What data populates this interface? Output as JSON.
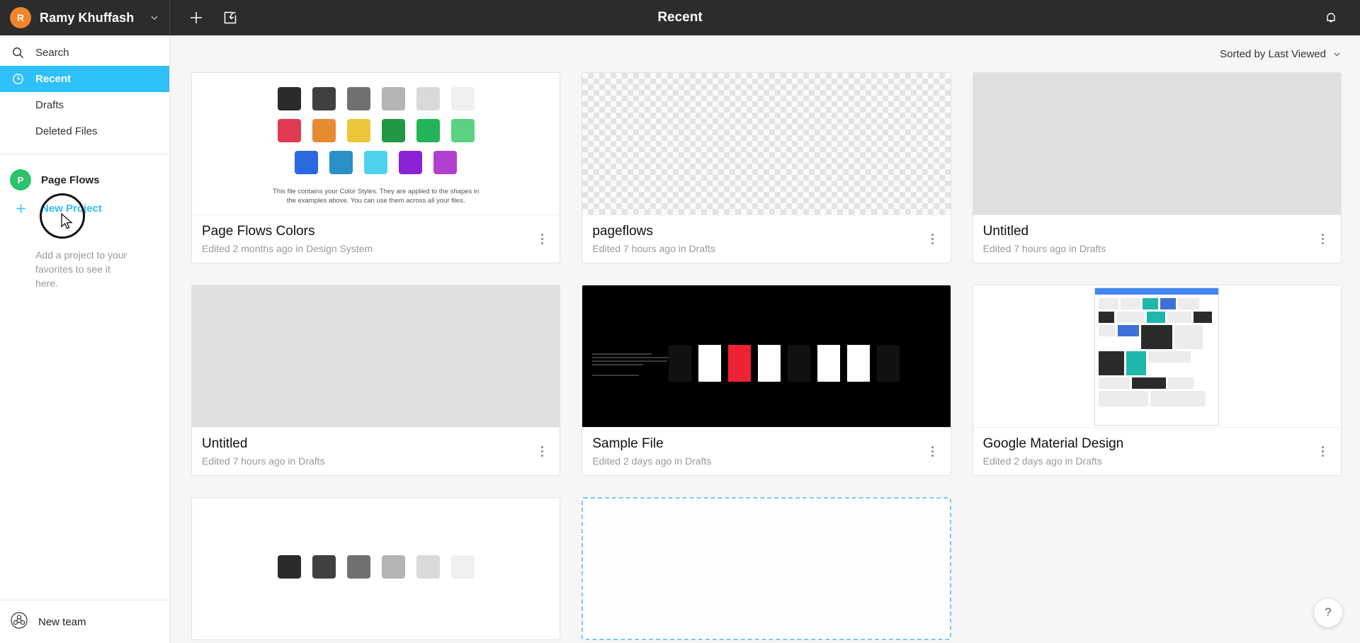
{
  "topbar": {
    "account_initial": "R",
    "account_name": "Ramy Khuffash",
    "title": "Recent",
    "new_icon": "plus-icon",
    "import_icon": "import-file-icon",
    "notification_icon": "bell-icon",
    "dropdown_icon": "chevron-down-icon",
    "accent": "#2ec0f9",
    "avatar_color": "#f2842a",
    "bg": "#2c2c2c"
  },
  "sidebar": {
    "nav": [
      {
        "label": "Search",
        "icon": "search-icon",
        "active": false
      },
      {
        "label": "Recent",
        "icon": "clock-icon",
        "active": true
      },
      {
        "label": "Drafts",
        "icon": "",
        "active": false
      },
      {
        "label": "Deleted Files",
        "icon": "",
        "active": false
      }
    ],
    "project": {
      "badge": "P",
      "label": "Page Flows",
      "badge_color": "#2cc36b"
    },
    "new_project": {
      "label": "New Project",
      "icon": "plus-icon"
    },
    "favorites_hint": "Add a project to your favorites to see it here.",
    "new_team": {
      "label": "New team",
      "icon": "team-icon"
    }
  },
  "toolbar": {
    "sort_label": "Sorted by Last Viewed",
    "sort_icon": "chevron-down-icon"
  },
  "files": [
    {
      "title": "Page Flows Colors",
      "meta": "Edited 2 months ago in Design System",
      "thumb": "palette",
      "palette_caption": "This file contains your Color Styles. They are applied to the shapes in the examples above. You can use them across all your files.",
      "palette_rows": [
        [
          "#2b2b2b",
          "#404040",
          "#707070",
          "#b4b4b4",
          "#d9d9d9",
          "#efefef"
        ],
        [
          "#e03a52",
          "#e78b33",
          "#edc73a",
          "#1f9945",
          "#22b457",
          "#5bd182"
        ],
        [
          "#2c68e0",
          "#2a90c8",
          "#4fd2ee",
          "#8c21d6",
          "#b13fd0"
        ]
      ]
    },
    {
      "title": "pageflows",
      "meta": "Edited 7 hours ago in Drafts",
      "thumb": "checker"
    },
    {
      "title": "Untitled",
      "meta": "Edited 7 hours ago in Drafts",
      "thumb": "grey"
    },
    {
      "title": "Untitled",
      "meta": "Edited 7 hours ago in Drafts",
      "thumb": "grey"
    },
    {
      "title": "Sample File",
      "meta": "Edited 2 days ago in Drafts",
      "thumb": "sample"
    },
    {
      "title": "Google Material Design",
      "meta": "Edited 2 days ago in Drafts",
      "thumb": "material"
    }
  ],
  "help": {
    "label": "?"
  }
}
